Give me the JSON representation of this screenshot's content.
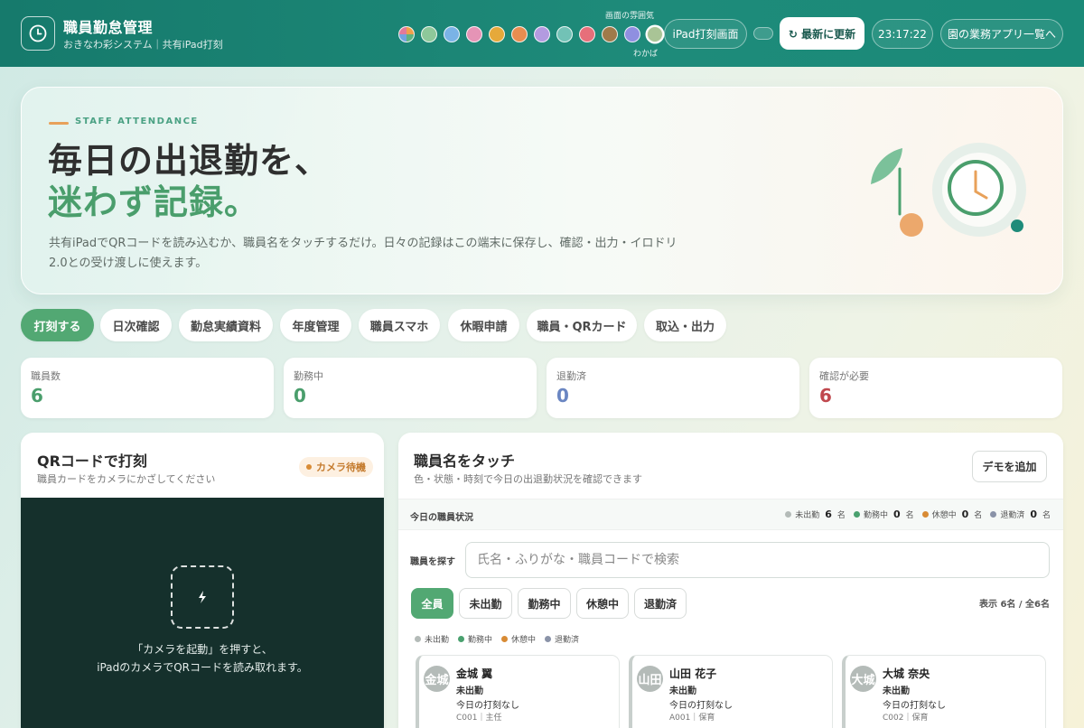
{
  "header": {
    "title": "職員勤怠管理",
    "subtitle": "おきなわ彩システム｜共有iPad打刻",
    "theme_label": "画面の雰囲気",
    "theme_current": "わかば",
    "swatches": [
      "#c9b8d9",
      "#8ec89a",
      "#7ab3e6",
      "#e594b6",
      "#e6a93a",
      "#e98d50",
      "#b39be0",
      "#72c2b6",
      "#e66f7a",
      "#a07a4a",
      "#8f8fe0",
      "#a9c496"
    ],
    "ipad_button": "iPad打刻画面",
    "refresh_button": "↻ 最新に更新",
    "clock": "23:17:22",
    "apps_button": "園の業務アプリ一覧へ"
  },
  "hero": {
    "eyebrow": "STAFF ATTENDANCE",
    "headline_1": "毎日の出退勤を、",
    "headline_2": "迷わず記録。",
    "description": "共有iPadでQRコードを読み込むか、職員名をタッチするだけ。日々の記録はこの端末に保存し、確認・出力・イロドリ2.0との受け渡しに使えます。"
  },
  "tabs": [
    "打刻する",
    "日次確認",
    "勤怠実績資料",
    "年度管理",
    "職員スマホ",
    "休暇申請",
    "職員・QRカード",
    "取込・出力"
  ],
  "stats": [
    {
      "label": "職員数",
      "value": "6",
      "color": "#4a9e6c"
    },
    {
      "label": "勤務中",
      "value": "0",
      "color": "#4a9e6c"
    },
    {
      "label": "退勤済",
      "value": "0",
      "color": "#6a86c2"
    },
    {
      "label": "確認が必要",
      "value": "6",
      "color": "#c0484e"
    }
  ],
  "qr": {
    "title": "QRコードで打刻",
    "subtitle": "職員カードをカメラにかざしてください",
    "badge": "カメラ待機",
    "instruction_1": "「カメラを起動」を押すと、",
    "instruction_2": "iPadのカメラでQRコードを読み取れます。"
  },
  "staff": {
    "title": "職員名をタッチ",
    "subtitle": "色・状態・時刻で今日の出退勤状況を確認できます",
    "demo_button": "デモを追加",
    "status_title": "今日の職員状況",
    "status_counts": [
      {
        "label": "未出勤",
        "count": "6",
        "unit": "名",
        "color": "#b4bbb8"
      },
      {
        "label": "勤務中",
        "count": "0",
        "unit": "名",
        "color": "#4aa16f"
      },
      {
        "label": "休憩中",
        "count": "0",
        "unit": "名",
        "color": "#d88b35"
      },
      {
        "label": "退勤済",
        "count": "0",
        "unit": "名",
        "color": "#8a93a8"
      }
    ],
    "search_label": "職員を探す",
    "search_placeholder": "氏名・ふりがな・職員コードで検索",
    "filters": [
      "全員",
      "未出勤",
      "勤務中",
      "休憩中",
      "退勤済"
    ],
    "display_count": "表示 6名 / 全6名",
    "legend": [
      {
        "label": "未出勤",
        "color": "#b4bbb8"
      },
      {
        "label": "勤務中",
        "color": "#4aa16f"
      },
      {
        "label": "休憩中",
        "color": "#d88b35"
      },
      {
        "label": "退勤済",
        "color": "#8a93a8"
      }
    ],
    "cards": [
      {
        "avatar": "金城",
        "name": "金城 翼",
        "status": "未出勤",
        "punch": "今日の打刻なし",
        "meta": "C001｜主任"
      },
      {
        "avatar": "山田",
        "name": "山田 花子",
        "status": "未出勤",
        "punch": "今日の打刻なし",
        "meta": "A001｜保育"
      },
      {
        "avatar": "大城",
        "name": "大城 奈央",
        "status": "未出勤",
        "punch": "今日の打刻なし",
        "meta": "C002｜保育"
      }
    ]
  }
}
